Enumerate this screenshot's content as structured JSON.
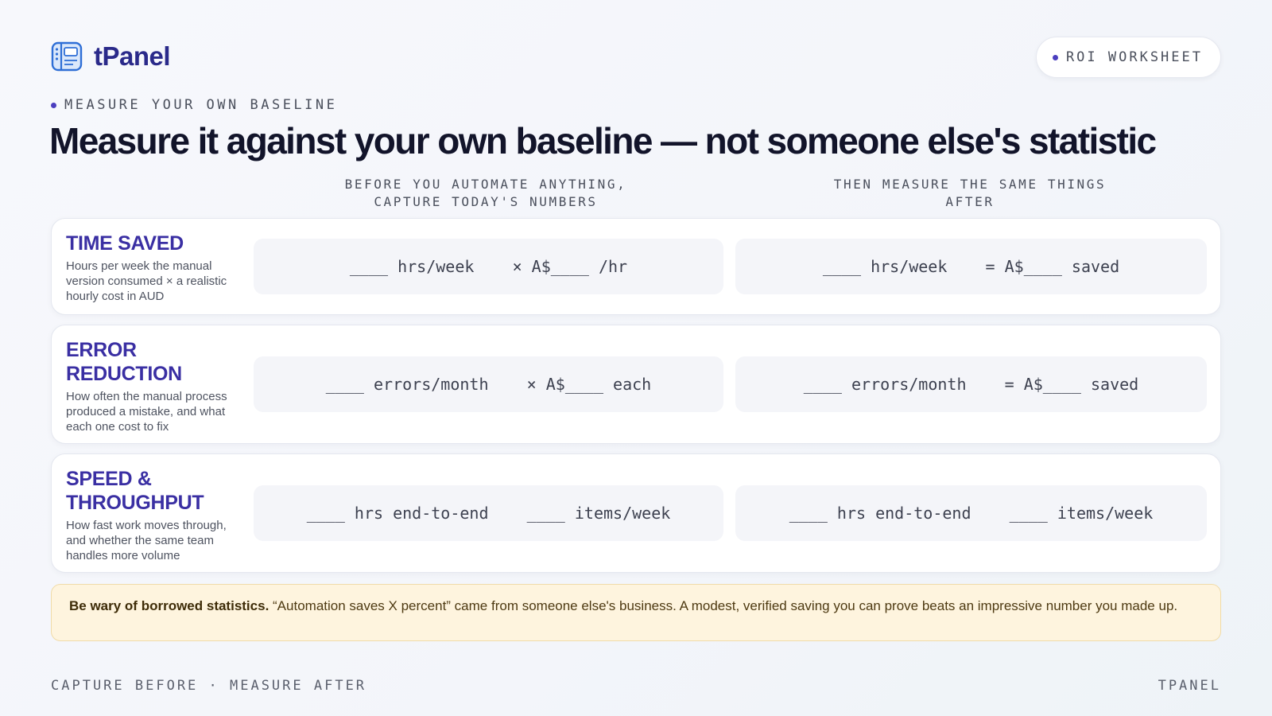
{
  "brand": {
    "name": "tPanel",
    "icon": "panel-layout-icon",
    "accent": "#2a2a8a"
  },
  "badge": {
    "label": "ROI WORKSHEET",
    "dot_color": "#4b3fbf"
  },
  "eyebrow": "MEASURE YOUR OWN BASELINE",
  "title": "Measure it against your own baseline — not someone else's statistic",
  "columns": {
    "before": {
      "line1": "BEFORE YOU AUTOMATE ANYTHING,",
      "line2": "CAPTURE TODAY'S NUMBERS"
    },
    "after": {
      "line1": "THEN MEASURE THE SAME THINGS",
      "line2": "AFTER"
    }
  },
  "rows": [
    {
      "title": "TIME SAVED",
      "description": "Hours per week the manual version consumed × a realistic hourly cost in AUD",
      "before": "____ hrs/week    × A$____ /hr",
      "after": "____ hrs/week    = A$____ saved"
    },
    {
      "title": "ERROR REDUCTION",
      "description": "How often the manual process produced a mistake, and what each one cost to fix",
      "before": "____ errors/month    × A$____ each",
      "after": "____ errors/month    = A$____ saved"
    },
    {
      "title": "SPEED & THROUGHPUT",
      "description": "How fast work moves through, and whether the same team handles more volume",
      "before": "____ hrs end-to-end    ____ items/week",
      "after": "____ hrs end-to-end    ____ items/week"
    }
  ],
  "callout": {
    "bold": "Be wary of borrowed statistics.",
    "text": " “Automation saves X percent” came from someone else's business. A modest, verified saving you can prove beats an impressive number you made up.",
    "background": "#fef4de"
  },
  "footer": {
    "left": "CAPTURE BEFORE · MEASURE AFTER",
    "right": "TPANEL"
  }
}
